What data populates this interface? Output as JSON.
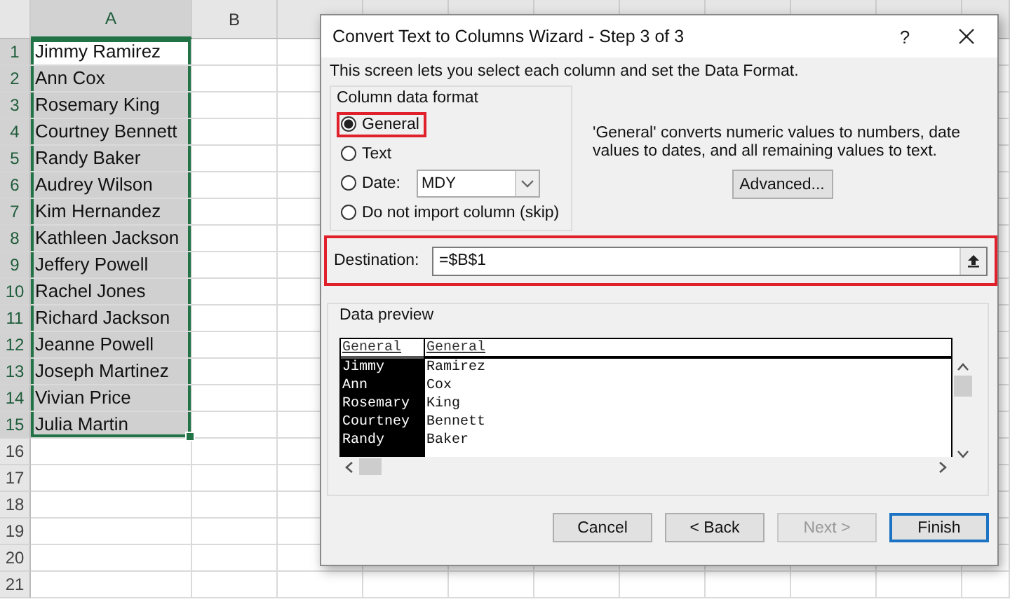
{
  "sheet": {
    "columns": [
      "A",
      "B"
    ],
    "rows": [
      {
        "number": "1",
        "cell_a": "Jimmy Ramirez",
        "selected": true,
        "active": true
      },
      {
        "number": "2",
        "cell_a": "Ann Cox",
        "selected": true,
        "active": false
      },
      {
        "number": "3",
        "cell_a": "Rosemary King",
        "selected": true,
        "active": false
      },
      {
        "number": "4",
        "cell_a": "Courtney Bennett",
        "selected": true,
        "active": false
      },
      {
        "number": "5",
        "cell_a": "Randy Baker",
        "selected": true,
        "active": false
      },
      {
        "number": "6",
        "cell_a": "Audrey Wilson",
        "selected": true,
        "active": false
      },
      {
        "number": "7",
        "cell_a": "Kim Hernandez",
        "selected": true,
        "active": false
      },
      {
        "number": "8",
        "cell_a": "Kathleen Jackson",
        "selected": true,
        "active": false
      },
      {
        "number": "9",
        "cell_a": "Jeffery Powell",
        "selected": true,
        "active": false
      },
      {
        "number": "10",
        "cell_a": "Rachel Jones",
        "selected": true,
        "active": false
      },
      {
        "number": "11",
        "cell_a": "Richard Jackson",
        "selected": true,
        "active": false
      },
      {
        "number": "12",
        "cell_a": "Jeanne Powell",
        "selected": true,
        "active": false
      },
      {
        "number": "13",
        "cell_a": "Joseph Martinez",
        "selected": true,
        "active": false
      },
      {
        "number": "14",
        "cell_a": "Vivian Price",
        "selected": true,
        "active": false
      },
      {
        "number": "15",
        "cell_a": "Julia Martin",
        "selected": true,
        "active": false
      }
    ],
    "empty_rows": [
      "16",
      "17",
      "18",
      "19",
      "20",
      "21"
    ]
  },
  "dialog": {
    "title": "Convert Text to Columns Wizard - Step 3 of 3",
    "help": "?",
    "intro": "This screen lets you select each column and set the Data Format.",
    "format_group": {
      "label": "Column data format",
      "options": [
        {
          "kind": "plain",
          "label": "General",
          "selected": true,
          "highlighted": true
        },
        {
          "kind": "plain",
          "label": "Text",
          "selected": false,
          "highlighted": false
        },
        {
          "kind": "date",
          "label": "Date:",
          "selected": false,
          "highlighted": false,
          "value": "MDY"
        },
        {
          "kind": "plain",
          "label": "Do not import column (skip)",
          "selected": false,
          "highlighted": false
        }
      ]
    },
    "description": "'General' converts numeric values to numbers, date values to dates, and all remaining values to text.",
    "advanced_button": "Advanced...",
    "destination": {
      "label": "Destination:",
      "value": "=$B$1",
      "highlighted": true
    },
    "preview": {
      "label": "Data preview",
      "columns": [
        {
          "header": "General",
          "selected": true
        },
        {
          "header": "General",
          "selected": false
        }
      ],
      "rows": [
        [
          "Jimmy",
          "Ramirez"
        ],
        [
          "Ann",
          "Cox"
        ],
        [
          "Rosemary",
          "King"
        ],
        [
          "Courtney",
          "Bennett"
        ],
        [
          "Randy",
          "Baker"
        ]
      ]
    },
    "buttons": [
      {
        "label": "Cancel",
        "disabled": false,
        "default": false
      },
      {
        "label": "< Back",
        "disabled": false,
        "default": false
      },
      {
        "label": "Next >",
        "disabled": true,
        "default": false
      },
      {
        "label": "Finish",
        "disabled": false,
        "default": true
      }
    ]
  }
}
